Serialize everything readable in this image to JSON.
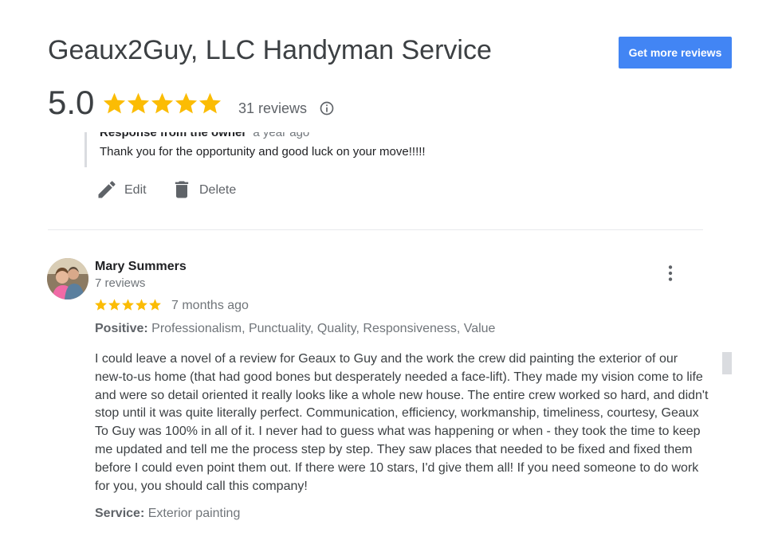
{
  "header": {
    "business_name": "Geaux2Guy, LLC Handyman Service",
    "cta_label": "Get more reviews",
    "cta_color": "#4285f4"
  },
  "summary": {
    "rating": "5.0",
    "stars": 5,
    "review_count_label": "31 reviews",
    "star_color": "#fbbc04"
  },
  "owner_response": {
    "heading": "Response from the owner",
    "time": "a year ago",
    "text": "Thank you for the opportunity and good luck on your move!!!!!"
  },
  "actions": {
    "edit_label": "Edit",
    "delete_label": "Delete"
  },
  "review": {
    "name": "Mary Summers",
    "meta": "7 reviews",
    "stars": 5,
    "date": "7 months ago",
    "positive_label": "Positive:",
    "positive_value": "Professionalism, Punctuality, Quality, Responsiveness, Value",
    "body": "I could leave a novel of a review for Geaux to Guy and the work the crew did painting the exterior of our new-to-us home (that had good bones but desperately needed a face-lift). They made my vision come to life and were so detail oriented it really looks like a whole new house. The entire crew worked so hard, and didn't stop until it was quite literally perfect. Communication, efficiency, workmanship, timeliness, courtesy, Geaux To Guy was 100% in all of it. I never had to guess what was happening or when - they took the time to keep me updated and tell me the process step by step. They saw places that needed to be fixed and fixed them before I could even point them out. If there were 10 stars, I'd give them all! If you need someone to do work for you, you should call this company!",
    "service_label": "Service:",
    "service_value": "Exterior painting"
  }
}
